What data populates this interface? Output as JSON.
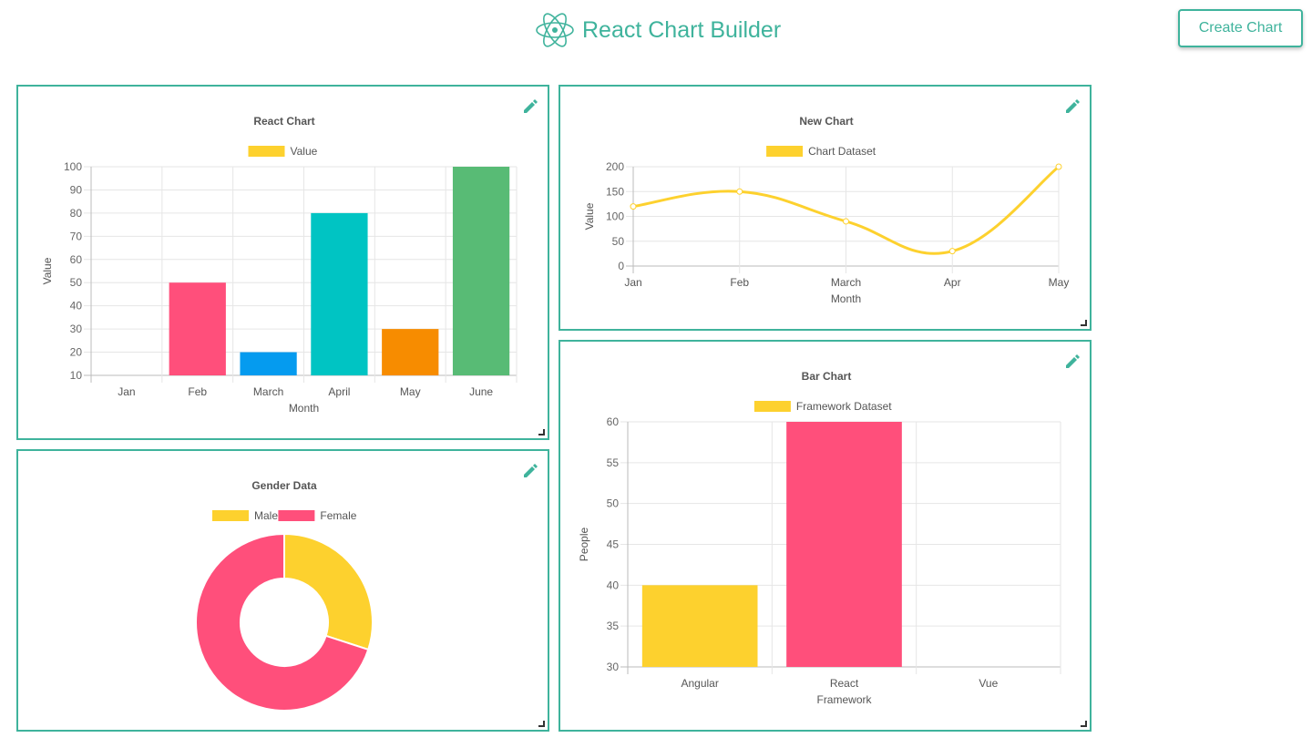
{
  "header": {
    "title": "React Chart Builder",
    "create_button": "Create Chart",
    "brand_color": "#3fb39c"
  },
  "chart_data": [
    {
      "type": "bar",
      "title": "React Chart",
      "legend": [
        "Value"
      ],
      "legend_colors": [
        "#fdd12e"
      ],
      "categories": [
        "Jan",
        "Feb",
        "March",
        "April",
        "May",
        "June"
      ],
      "series": [
        {
          "name": "Value",
          "values": [
            10,
            50,
            20,
            80,
            30,
            100
          ]
        }
      ],
      "bar_colors": [
        "#ff4f7b",
        "#ff4f7b",
        "#059bef",
        "#00c4c3",
        "#f78c00",
        "#58bb75"
      ],
      "xlabel": "Month",
      "ylabel": "Value",
      "ylim": [
        10,
        100
      ],
      "yticks": [
        10,
        20,
        30,
        40,
        50,
        60,
        70,
        80,
        90,
        100
      ],
      "grid": true,
      "legend_position": "top"
    },
    {
      "type": "line",
      "title": "New Chart",
      "legend": [
        "Chart Dataset"
      ],
      "legend_colors": [
        "#fdd12e"
      ],
      "categories": [
        "Jan",
        "Feb",
        "March",
        "Apr",
        "May"
      ],
      "series": [
        {
          "name": "Chart Dataset",
          "values": [
            120,
            150,
            90,
            30,
            200
          ]
        }
      ],
      "xlabel": "Month",
      "ylabel": "Value",
      "ylim": [
        0,
        200
      ],
      "yticks": [
        0,
        50,
        100,
        150,
        200
      ],
      "grid": true,
      "legend_position": "top"
    },
    {
      "type": "pie",
      "title": "Gender Data",
      "legend": [
        "Male",
        "Female"
      ],
      "legend_colors": [
        "#fdd12e",
        "#ff4f7b"
      ],
      "categories": [
        "Male",
        "Female"
      ],
      "values": [
        30,
        70
      ],
      "legend_position": "top"
    },
    {
      "type": "bar",
      "title": "Bar Chart",
      "legend": [
        "Framework Dataset"
      ],
      "legend_colors": [
        "#fdd12e"
      ],
      "categories": [
        "Angular",
        "React",
        "Vue"
      ],
      "series": [
        {
          "name": "Framework Dataset",
          "values": [
            40,
            60,
            30
          ]
        }
      ],
      "bar_colors": [
        "#fdd12e",
        "#ff4f7b",
        "#059bef"
      ],
      "xlabel": "Framework",
      "ylabel": "People",
      "ylim": [
        30,
        60
      ],
      "yticks": [
        30,
        35,
        40,
        45,
        50,
        55,
        60
      ],
      "grid": true,
      "legend_position": "top"
    }
  ]
}
